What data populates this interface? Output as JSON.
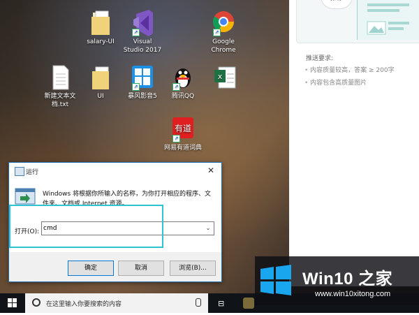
{
  "desktop": {
    "icons": [
      {
        "label": "salary-UI"
      },
      {
        "label": "Visual\nStudio 2017"
      },
      {
        "label": "Google\nChrome"
      },
      {
        "label": "新建文本文\n档.txt"
      },
      {
        "label": "UI"
      },
      {
        "label": "暴风影音5"
      },
      {
        "label": "腾讯QQ"
      },
      {
        "label": "网易有道词典"
      }
    ]
  },
  "right_panel": {
    "preview_tag": "推荐",
    "title": "推送要求:",
    "items": [
      "内容质量较高，答案 ≥ 200字",
      "内容包含高质量图片"
    ]
  },
  "run_dialog": {
    "title": "运行",
    "close": "✕",
    "description": "Windows 将根据你所输入的名称，为你打开相应的程序、文件夹、文档或 Internet 资源。",
    "open_label": "打开(O):",
    "input_value": "cmd",
    "dropdown": "⌄",
    "buttons": {
      "ok": "确定",
      "cancel": "取消",
      "browse": "浏览(B)..."
    }
  },
  "taskbar": {
    "search_placeholder": "在这里输入你要搜索的内容",
    "taskview": "⊟"
  },
  "watermark": {
    "title": "Win10 之家",
    "subtitle": "www.win10xitong.com"
  },
  "colors": {
    "accent": "#0078d7",
    "highlight": "#2fc4d0",
    "taskbar": "#101418"
  }
}
